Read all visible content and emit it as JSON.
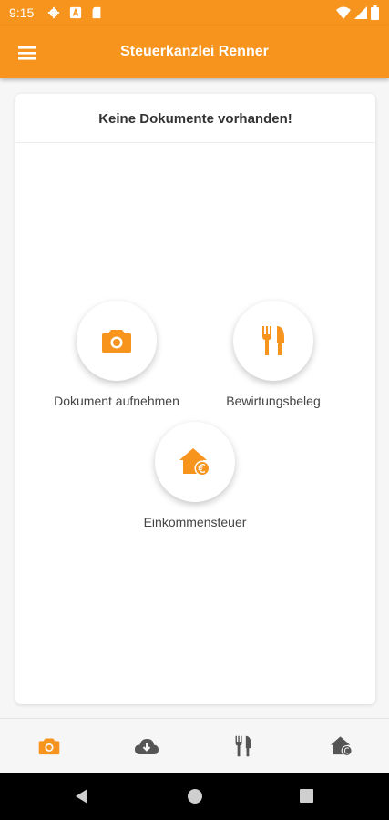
{
  "status_bar": {
    "time": "9:15",
    "icons": [
      "gear-icon",
      "a-icon",
      "sd-card-icon",
      "wifi-icon",
      "signal-icon",
      "battery-icon"
    ]
  },
  "app_bar": {
    "title": "Steuerkanzlei Renner",
    "menu_icon": "hamburger-menu-icon"
  },
  "card": {
    "header": "Keine Dokumente vorhanden!"
  },
  "actions": [
    {
      "label": "Dokument aufnehmen",
      "icon": "camera-icon"
    },
    {
      "label": "Bewirtungsbeleg",
      "icon": "fork-knife-icon"
    },
    {
      "label": "Einkommensteuer",
      "icon": "house-euro-icon"
    }
  ],
  "bottom_nav": [
    {
      "icon": "camera-icon",
      "active": true
    },
    {
      "icon": "cloud-download-icon",
      "active": false
    },
    {
      "icon": "fork-knife-icon",
      "active": false
    },
    {
      "icon": "house-euro-icon",
      "active": false
    }
  ],
  "system_nav": [
    "back-icon",
    "home-icon",
    "recents-icon"
  ],
  "colors": {
    "accent": "#f7941d",
    "nav_inactive": "#555555",
    "text": "#333333"
  }
}
